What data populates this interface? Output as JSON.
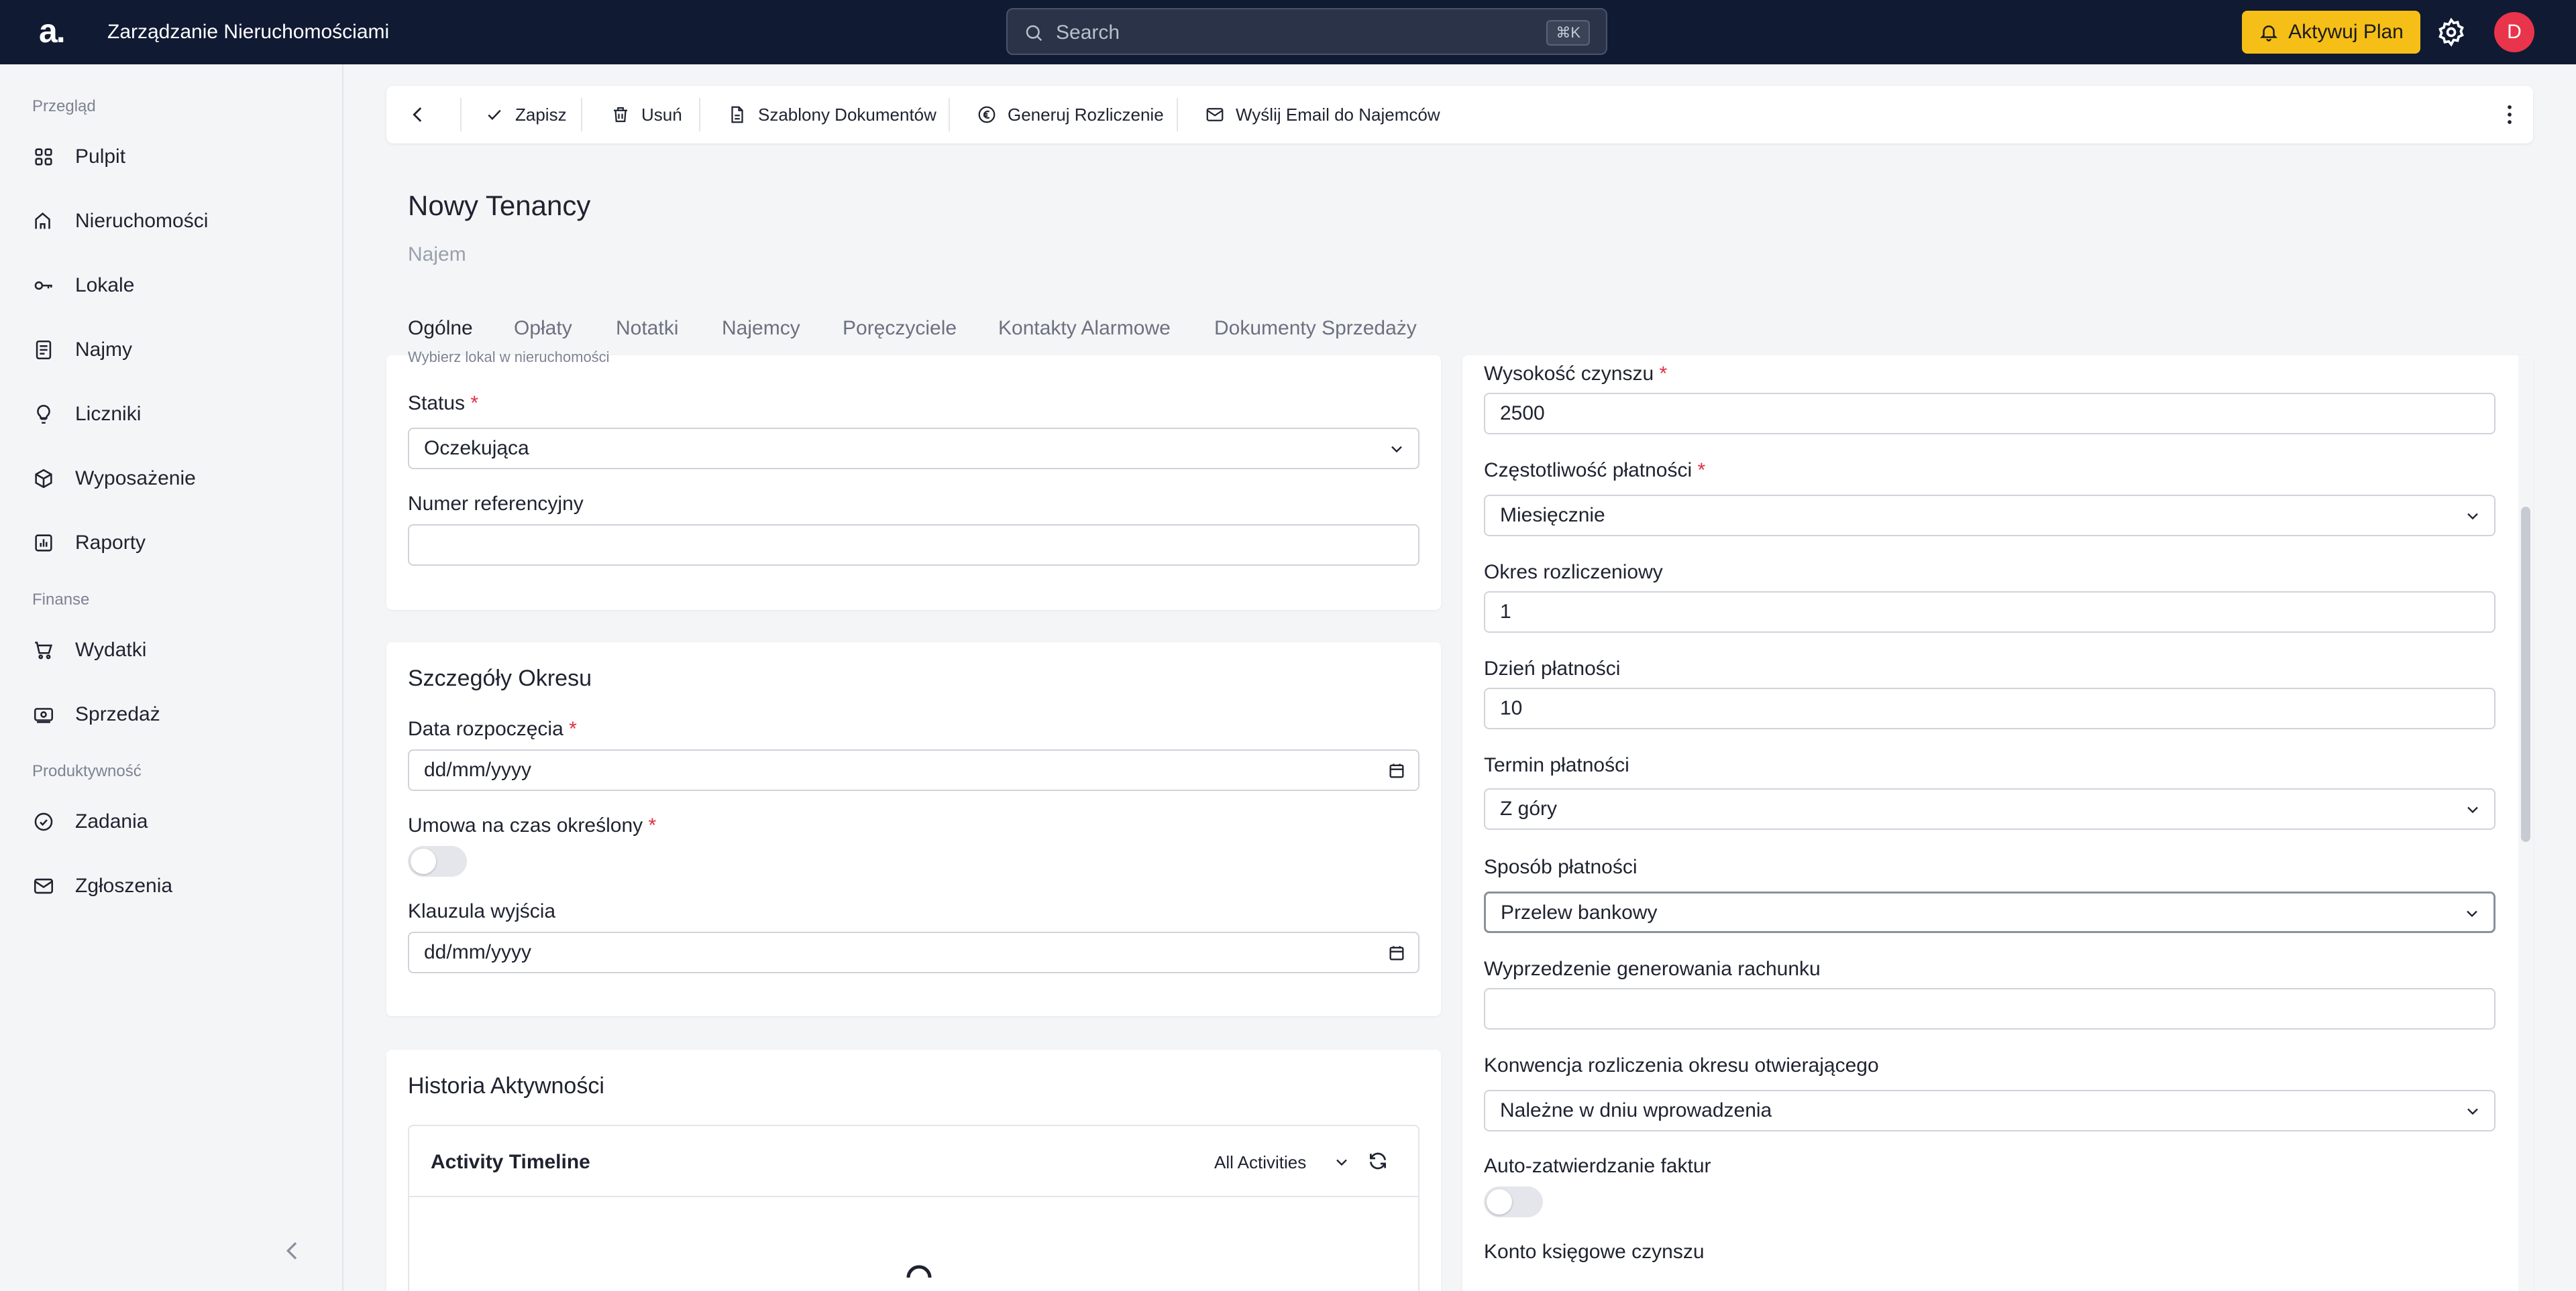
{
  "topbar": {
    "logo": "a.",
    "app_title": "Zarządzanie Nieruchomościami",
    "search_placeholder": "Search",
    "search_shortcut": "⌘K",
    "upgrade_label": "Aktywuj Plan",
    "avatar_initial": "D"
  },
  "sidebar": {
    "sections": {
      "overview": "Przegląd",
      "finance": "Finanse",
      "productivity": "Produktywność"
    },
    "items": [
      {
        "label": "Pulpit",
        "icon": "dashboard-icon"
      },
      {
        "label": "Nieruchomości",
        "icon": "building-icon"
      },
      {
        "label": "Lokale",
        "icon": "key-icon"
      },
      {
        "label": "Najmy",
        "icon": "document-icon"
      },
      {
        "label": "Liczniki",
        "icon": "lightbulb-icon"
      },
      {
        "label": "Wyposażenie",
        "icon": "box-icon"
      },
      {
        "label": "Raporty",
        "icon": "chart-icon"
      },
      {
        "label": "Wydatki",
        "icon": "cart-icon"
      },
      {
        "label": "Sprzedaż",
        "icon": "money-icon"
      },
      {
        "label": "Zadania",
        "icon": "check-circle-icon"
      },
      {
        "label": "Zgłoszenia",
        "icon": "mail-icon"
      }
    ]
  },
  "toolbar": {
    "save": "Zapisz",
    "delete": "Usuń",
    "templates": "Szablony Dokumentów",
    "generate": "Generuj Rozliczenie",
    "email": "Wyślij Email do Najemców"
  },
  "page": {
    "title": "Nowy Tenancy",
    "subtitle": "Najem"
  },
  "tabs": [
    "Ogólne",
    "Opłaty",
    "Notatki",
    "Najemcy",
    "Poręczyciele",
    "Kontakty Alarmowe",
    "Dokumenty Sprzedaży"
  ],
  "general_card": {
    "cut_hint": "Wybierz lokal w nieruchomości",
    "status_label": "Status",
    "status_value": "Oczekująca",
    "reference_label": "Numer referencyjny",
    "reference_value": ""
  },
  "period_card": {
    "title": "Szczegóły Okresu",
    "start_label": "Data rozpoczęcia",
    "start_placeholder": "dd/mm/yyyy",
    "fixed_term_label": "Umowa na czas określony",
    "fixed_term_on": false,
    "exit_label": "Klauzula wyjścia",
    "exit_placeholder": "dd/mm/yyyy"
  },
  "activity_card": {
    "title": "Historia Aktywności",
    "timeline_title": "Activity Timeline",
    "filter": "All Activities"
  },
  "payment_card": {
    "rent_label": "Wysokość czynszu",
    "rent_value": "2500",
    "frequency_label": "Częstotliwość płatności",
    "frequency_value": "Miesięcznie",
    "period_label": "Okres rozliczeniowy",
    "period_value": "1",
    "day_label": "Dzień płatności",
    "day_value": "10",
    "term_label": "Termin płatności",
    "term_value": "Z góry",
    "method_label": "Sposób płatności",
    "method_value": "Przelew bankowy",
    "advance_label": "Wyprzedzenie generowania rachunku",
    "advance_value": "",
    "convention_label": "Konwencja rozliczenia okresu otwierającego",
    "convention_value": "Należne w dniu wprowadzenia",
    "auto_label": "Auto-zatwierdzanie faktur",
    "auto_on": false,
    "account_label": "Konto księgowe czynszu"
  },
  "colors": {
    "topbar": "#101a33",
    "accent": "#f5bf17",
    "avatar": "#e8354b",
    "required": "#e02f44"
  }
}
